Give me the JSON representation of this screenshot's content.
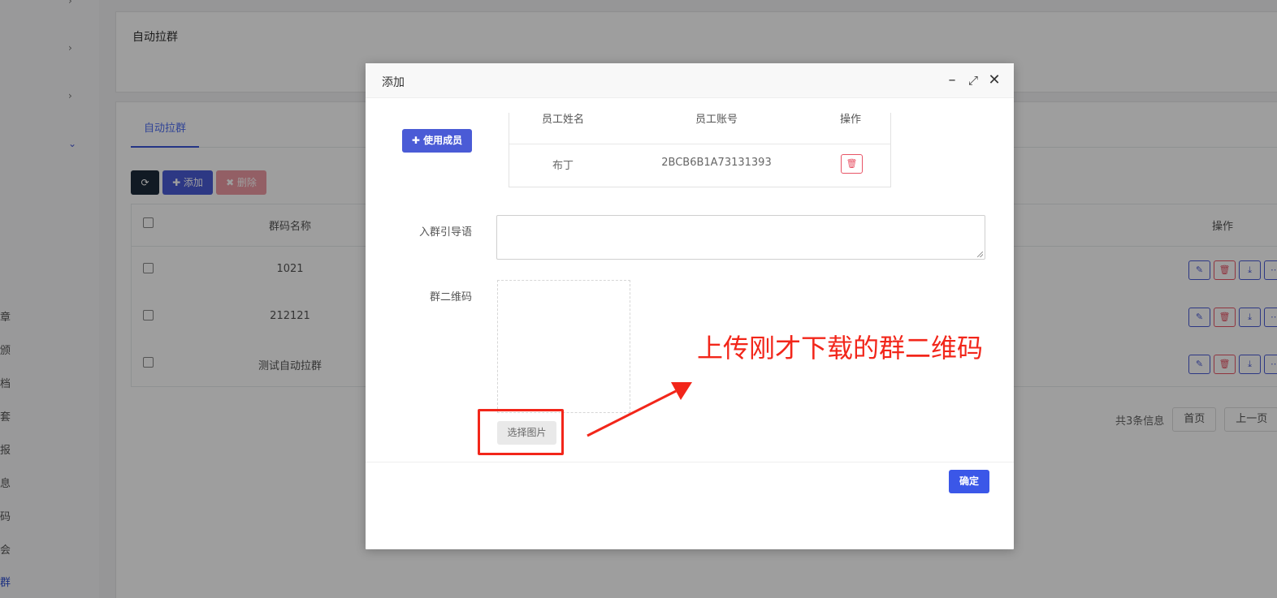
{
  "sidebar": {
    "items": [
      "章",
      "颁",
      "档",
      "套",
      "报",
      "息",
      "码",
      "会",
      "群"
    ]
  },
  "page": {
    "title": "自动拉群"
  },
  "tabs": [
    {
      "label": "自动拉群"
    }
  ],
  "toolbar": {
    "refresh_icon": "refresh-icon",
    "add_label": "✚ 添加",
    "delete_label": "✖ 删除"
  },
  "grid": {
    "columns": {
      "name": "群码名称",
      "op": "操作"
    },
    "rows": [
      {
        "name": "1021"
      },
      {
        "name": "212121"
      },
      {
        "name": "测试自动拉群"
      }
    ]
  },
  "pager": {
    "info": "共3条信息",
    "first": "首页",
    "prev": "上一页"
  },
  "modal": {
    "title": "添加",
    "use_member_label": "✚ 使用成员",
    "table": {
      "headers": [
        "员工姓名",
        "员工账号",
        "操作"
      ],
      "rows": [
        {
          "name": "布丁",
          "account": "2BCB6B1A73131393"
        }
      ]
    },
    "guide_label": "入群引导语",
    "guide_value": "",
    "qr_label": "群二维码",
    "pick_image_label": "选择图片",
    "confirm_label": "确定",
    "annotation": "上传刚才下载的群二维码"
  },
  "colors": {
    "accent": "#4a5bd6",
    "danger": "#e85466",
    "annotation": "#f2261a"
  }
}
